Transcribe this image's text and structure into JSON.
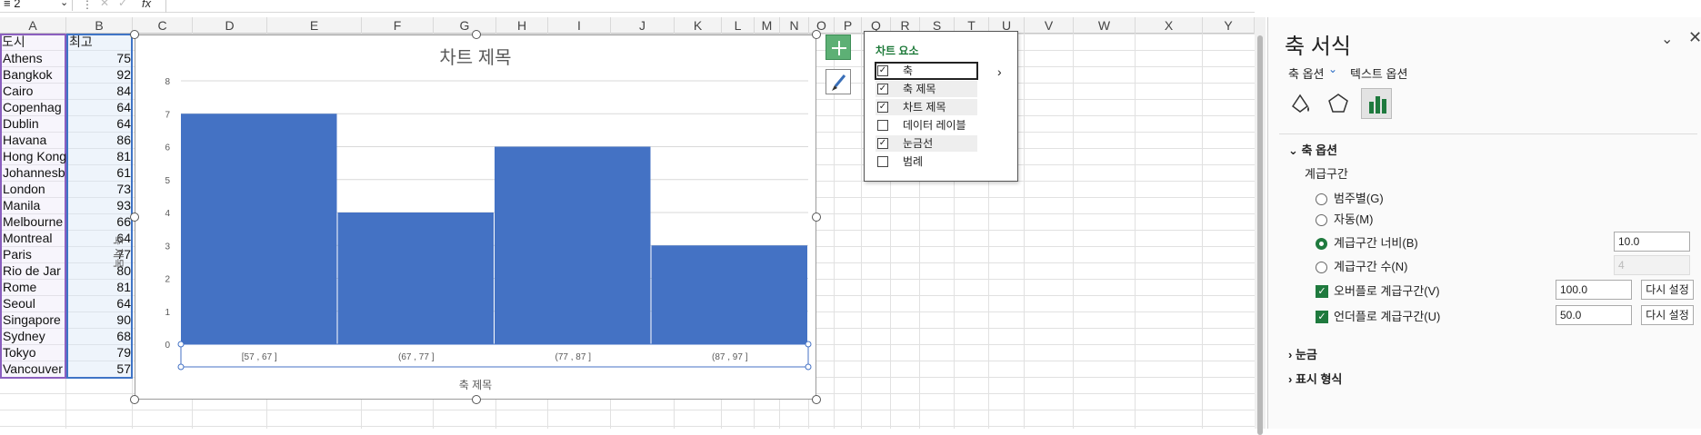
{
  "formula_bar": {
    "name_box": "≡ 2",
    "fx": "fx",
    "x": "✕",
    "check": "✓"
  },
  "columns": [
    "A",
    "B",
    "C",
    "D",
    "E",
    "F",
    "G",
    "H",
    "I",
    "J",
    "K",
    "L",
    "M",
    "N",
    "O",
    "P",
    "Q",
    "R",
    "S",
    "T",
    "U",
    "V",
    "W",
    "X",
    "Y"
  ],
  "sheet": {
    "header_a": "도시",
    "header_b": "최고",
    "rows": [
      {
        "city": "Athens",
        "value": "75"
      },
      {
        "city": "Bangkok",
        "value": "92"
      },
      {
        "city": "Cairo",
        "value": "84"
      },
      {
        "city": "Copenhag",
        "value": "64"
      },
      {
        "city": "Dublin",
        "value": "64"
      },
      {
        "city": "Havana",
        "value": "86"
      },
      {
        "city": "Hong Kong",
        "value": "81"
      },
      {
        "city": "Johannesb",
        "value": "61"
      },
      {
        "city": "London",
        "value": "73"
      },
      {
        "city": "Manila",
        "value": "93"
      },
      {
        "city": "Melbourne",
        "value": "66"
      },
      {
        "city": "Montreal",
        "value": "64"
      },
      {
        "city": "Paris",
        "value": "77"
      },
      {
        "city": "Rio de Jar",
        "value": "80"
      },
      {
        "city": "Rome",
        "value": "81"
      },
      {
        "city": "Seoul",
        "value": "64"
      },
      {
        "city": "Singapore",
        "value": "90"
      },
      {
        "city": "Sydney",
        "value": "68"
      },
      {
        "city": "Tokyo",
        "value": "79"
      },
      {
        "city": "Vancouver",
        "value": "57"
      }
    ]
  },
  "chart_data": {
    "type": "bar",
    "title": "차트 제목",
    "xlabel": "축 제목",
    "ylabel": "축 제목",
    "categories": [
      "[57 , 67 ]",
      "(67 , 77 ]",
      "(77 , 87 ]",
      "(87 , 97 ]"
    ],
    "values": [
      7,
      4,
      6,
      3
    ],
    "ylim": [
      0,
      8
    ],
    "yticks": [
      "0",
      "1",
      "2",
      "3",
      "4",
      "5",
      "6",
      "7",
      "8"
    ],
    "grid": true,
    "color": "#4472c4"
  },
  "chart_elements": {
    "title": "차트 요소",
    "items": [
      {
        "label": "축",
        "checked": true
      },
      {
        "label": "축 제목",
        "checked": true
      },
      {
        "label": "차트 제목",
        "checked": true
      },
      {
        "label": "데이터 레이블",
        "checked": false
      },
      {
        "label": "눈금선",
        "checked": true
      },
      {
        "label": "범례",
        "checked": false
      }
    ],
    "arrow": "›"
  },
  "pane": {
    "title": "축 서식",
    "chevron": "⌄",
    "close": "✕",
    "tab_axis": "축 옵션",
    "tab_axis_chevron": "⌄",
    "tab_text": "텍스트 옵션",
    "section_axis": "⌄  축 옵션",
    "bins_label": "계급구간",
    "radio_category": "범주별(G)",
    "radio_auto": "자동(M)",
    "radio_width": "계급구간 너비(B)",
    "radio_count": "계급구간 수(N)",
    "width_value": "10.0",
    "count_value": "4",
    "overflow_label": "오버플로 계급구간(V)",
    "overflow_value": "100.0",
    "underflow_label": "언더플로 계급구간(U)",
    "underflow_value": "50.0",
    "reset": "다시 설정",
    "section_ticks": "›  눈금",
    "section_format": "›  표시 형식"
  },
  "colors": {
    "accent_green": "#1f7a3e",
    "bar_blue": "#4472c4",
    "range_purple": "#8b5fbf"
  }
}
